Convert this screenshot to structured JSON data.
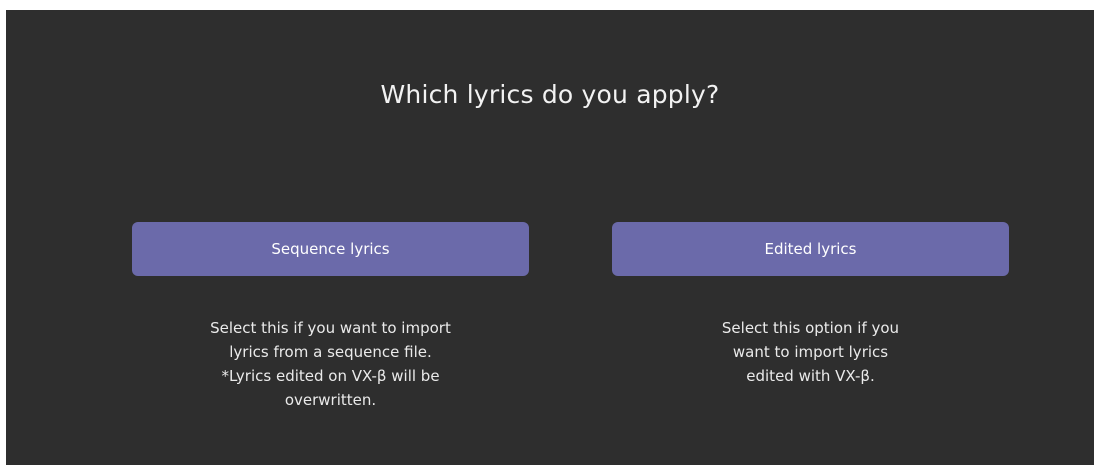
{
  "dialog": {
    "title": "Which lyrics do you apply?",
    "colors": {
      "background": "#2e2e2e",
      "button": "#6b6aaa",
      "text": "#f2f2f2"
    }
  },
  "options": [
    {
      "button_label": "Sequence lyrics",
      "description_lines": [
        "Select this if you want to import",
        "lyrics from a sequence file.",
        "*Lyrics edited on VX-β will be",
        "overwritten."
      ]
    },
    {
      "button_label": "Edited lyrics",
      "description_lines": [
        "Select this option if you",
        "want to import lyrics",
        "edited with VX-β."
      ]
    }
  ]
}
